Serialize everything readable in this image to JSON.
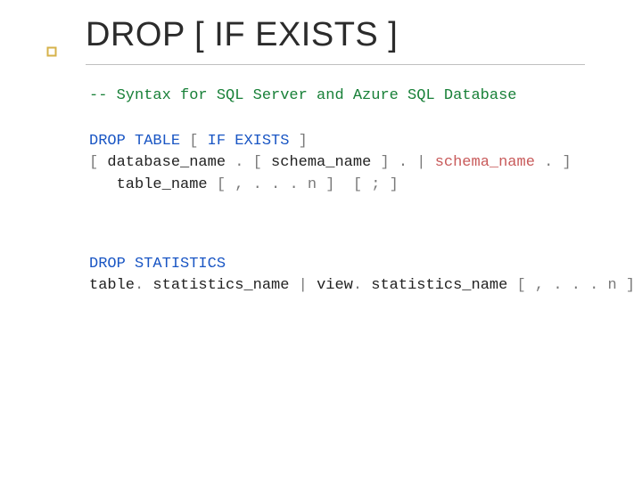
{
  "title": "DROP [ IF EXISTS ]",
  "comment_line": "-- Syntax for SQL Server and Azure SQL Database",
  "block1": {
    "l1": {
      "kw_drop": "DROP",
      "kw_table": "TABLE",
      "gray_open": " [ ",
      "kw_if": "IF",
      "kw_exists": "EXISTS",
      "gray_close": " ]"
    },
    "l2": {
      "gray1": "[ ",
      "id_db": "database_name",
      "gray2": " . [ ",
      "id_schema": "schema_name",
      "gray3": " ] . | ",
      "red_schema": "schema_name",
      "gray4": " . ]"
    },
    "l3": {
      "indent": "   ",
      "id_table": "table_name",
      "gray": " [ , . . . n ]  [ ; ]"
    }
  },
  "block2": {
    "l1": {
      "kw_drop": "DROP",
      "kw_stats": "STATISTICS"
    },
    "l2": {
      "id_table": "table",
      "gray_dot1": ". ",
      "id_stats1": "statistics_name",
      "gray_pipe": " | ",
      "id_view": "view",
      "gray_dot2": ". ",
      "id_stats2": "statistics_name",
      "gray_tail": " [ , . . . n ]"
    }
  }
}
